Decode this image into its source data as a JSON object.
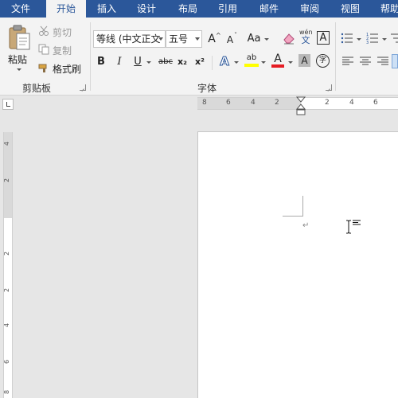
{
  "tabs": [
    {
      "label": "文件",
      "active": false
    },
    {
      "label": "开始",
      "active": true
    },
    {
      "label": "插入",
      "active": false
    },
    {
      "label": "设计",
      "active": false
    },
    {
      "label": "布局",
      "active": false
    },
    {
      "label": "引用",
      "active": false
    },
    {
      "label": "邮件",
      "active": false
    },
    {
      "label": "审阅",
      "active": false
    },
    {
      "label": "视图",
      "active": false
    },
    {
      "label": "帮助",
      "active": false
    }
  ],
  "clipboard": {
    "paste_label": "粘贴",
    "cut_label": "剪切",
    "copy_label": "复制",
    "format_painter_label": "格式刷",
    "group_label": "剪贴板"
  },
  "font": {
    "font_name": "等线 (中文正文",
    "font_size": "五号",
    "group_label": "字体",
    "grow_font": "A",
    "shrink_font": "A",
    "change_case": "Aa",
    "pinyin_top": "wén",
    "pinyin_bottom": "文",
    "char_border": "A",
    "bold": "B",
    "italic": "I",
    "underline": "U",
    "strikethrough": "abc",
    "subscript": "x₂",
    "superscript": "x²",
    "text_effects": "A",
    "highlight": "ab",
    "font_color": "A",
    "char_shading": "A",
    "enclose_char": "字"
  },
  "ruler": {
    "h_labels": [
      "8",
      "6",
      "4",
      "2",
      "2",
      "4",
      "6"
    ],
    "v_labels": [
      "4",
      "2",
      "2",
      "2",
      "4",
      "6",
      "8"
    ]
  },
  "colors": {
    "tab_bar": "#2b579a",
    "ribbon": "#f3f3f3",
    "highlight_yellow": "#ffff00",
    "font_red": "#e51c23"
  },
  "icons": {
    "paste": "clipboard-icon",
    "cut": "scissors-icon",
    "copy": "copy-icon",
    "format_painter": "brush-icon",
    "eraser": "eraser-icon"
  }
}
